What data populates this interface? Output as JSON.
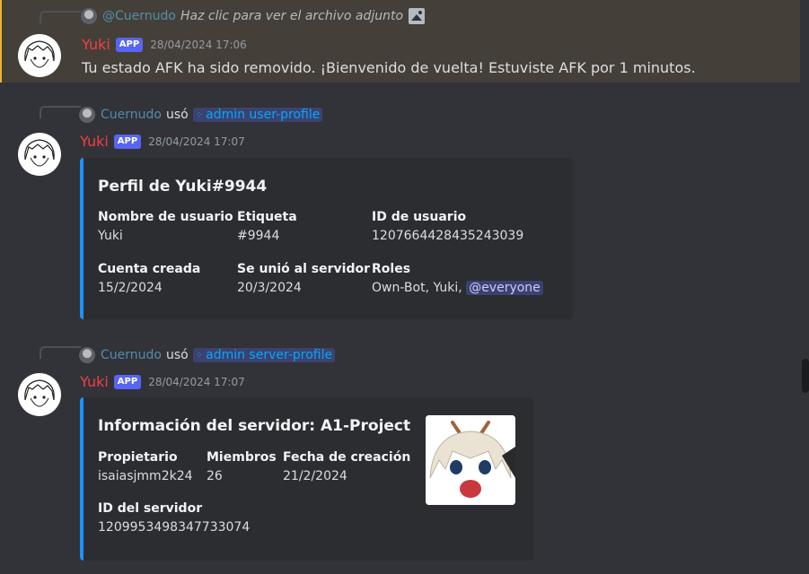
{
  "messages": [
    {
      "reply": {
        "user": "@Cuernudo",
        "text": "Haz clic para ver el archivo adjunto"
      },
      "author": "Yuki",
      "badge": "APP",
      "timestamp": "28/04/2024 17:06",
      "content": "Tu estado AFK ha sido removido. ¡Bienvenido de vuelta! Estuviste AFK por 1 minutos."
    },
    {
      "reply": {
        "user": "Cuernudo",
        "used": "usó",
        "command": "admin user-profile"
      },
      "author": "Yuki",
      "badge": "APP",
      "timestamp": "28/04/2024 17:07",
      "embed": {
        "title": "Perfil de Yuki#9944",
        "fields": [
          {
            "name": "Nombre de usuario",
            "value": "Yuki"
          },
          {
            "name": "Etiqueta",
            "value": "#9944"
          },
          {
            "name": "ID de usuario",
            "value": "1207664428435243039"
          },
          {
            "name": "Cuenta creada",
            "value": "15/2/2024"
          },
          {
            "name": "Se unió al servidor",
            "value": "20/3/2024"
          },
          {
            "name": "Roles",
            "value": "Own-Bot, Yuki,",
            "mention": "@everyone"
          }
        ]
      }
    },
    {
      "reply": {
        "user": "Cuernudo",
        "used": "usó",
        "command": "admin server-profile"
      },
      "author": "Yuki",
      "badge": "APP",
      "timestamp": "28/04/2024 17:07",
      "embed": {
        "title": "Información del servidor: A1-Project",
        "fields": [
          {
            "name": "Propietario",
            "value": "isaiasjmm2k24"
          },
          {
            "name": "Miembros",
            "value": "26"
          },
          {
            "name": "Fecha de creación",
            "value": "21/2/2024"
          },
          {
            "name": "ID del servidor",
            "value": "1209953498347733074"
          }
        ]
      }
    }
  ],
  "colors": {
    "accent": "#1e90ff",
    "author": "#f23f43",
    "highlight_border": "#f0b232"
  },
  "icons": {
    "attachment": "image-icon",
    "command": "slash-command-icon"
  }
}
